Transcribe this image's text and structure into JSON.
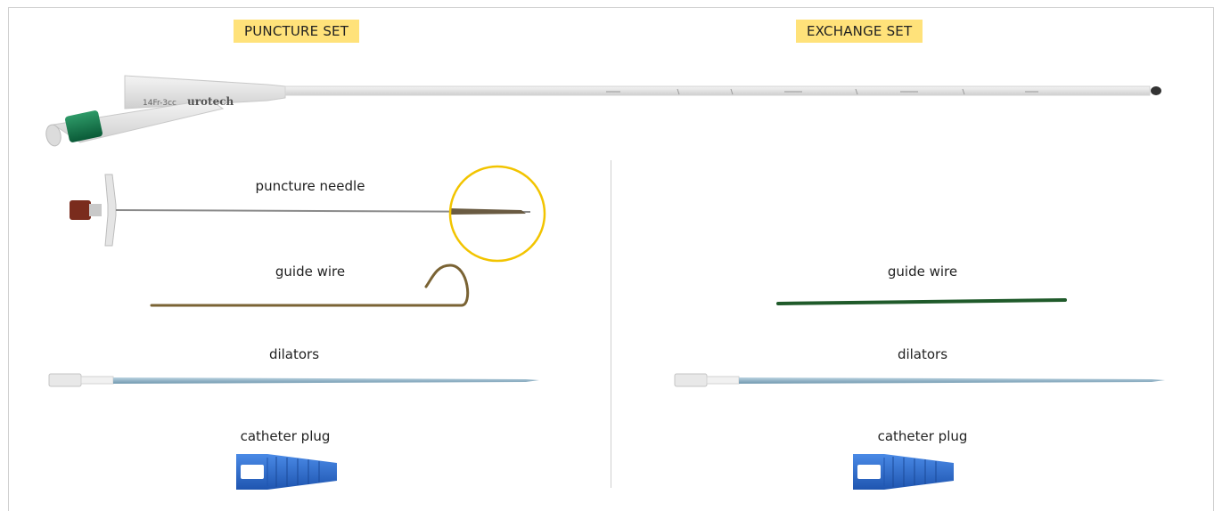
{
  "colors": {
    "label_highlight": "#ffe27a",
    "needle_circle": "#f2c400",
    "catheter_green": "#0f7a4e",
    "catheter_body": "#eaeaea",
    "needle_hub": "#7a2c1d",
    "guide_wire_brown": "#7a6334",
    "guide_wire_green": "#1f5a2a",
    "dilator_shaft": "#8db3c9",
    "plug_blue": "#2f6fd0"
  },
  "catheter": {
    "brand_text": "urotech",
    "size_text": "14Fr-3cc"
  },
  "puncture_set": {
    "title": "PUNCTURE SET",
    "items": {
      "puncture_needle": "puncture needle",
      "guide_wire": "guide wire",
      "dilators": "dilators",
      "catheter_plug": "catheter plug"
    }
  },
  "exchange_set": {
    "title": "EXCHANGE SET",
    "items": {
      "guide_wire": "guide wire",
      "dilators": "dilators",
      "catheter_plug": "catheter plug"
    }
  }
}
